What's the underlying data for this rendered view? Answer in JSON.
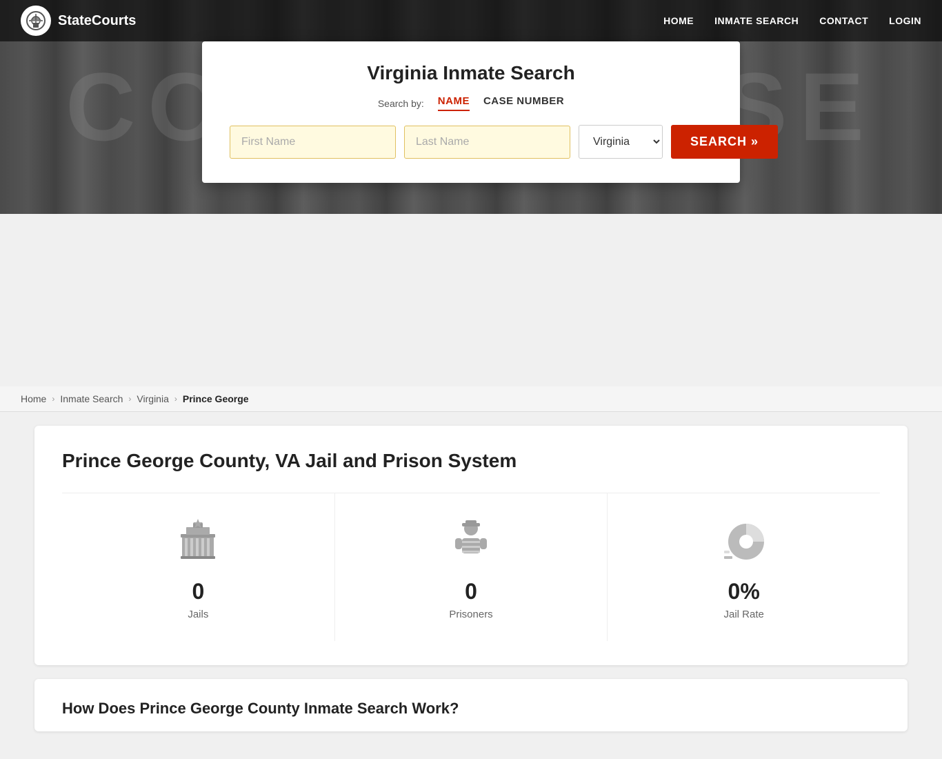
{
  "nav": {
    "logo_text": "StateCourts",
    "links": [
      "HOME",
      "INMATE SEARCH",
      "CONTACT",
      "LOGIN"
    ]
  },
  "header": {
    "bg_text": "COURTHOUSE"
  },
  "search_card": {
    "title": "Virginia Inmate Search",
    "search_by_label": "Search by:",
    "tabs": [
      {
        "id": "name",
        "label": "NAME",
        "active": true
      },
      {
        "id": "case",
        "label": "CASE NUMBER",
        "active": false
      }
    ],
    "first_name_placeholder": "First Name",
    "last_name_placeholder": "Last Name",
    "state_value": "Virginia",
    "search_button_label": "SEARCH »"
  },
  "breadcrumb": {
    "items": [
      {
        "label": "Home",
        "link": true
      },
      {
        "label": "Inmate Search",
        "link": true
      },
      {
        "label": "Virginia",
        "link": true
      },
      {
        "label": "Prince George",
        "link": false
      }
    ]
  },
  "main_card": {
    "title": "Prince George County, VA Jail and Prison System",
    "stats": [
      {
        "id": "jails",
        "value": "0",
        "label": "Jails"
      },
      {
        "id": "prisoners",
        "value": "0",
        "label": "Prisoners"
      },
      {
        "id": "jail_rate",
        "value": "0%",
        "label": "Jail Rate"
      }
    ]
  },
  "second_card": {
    "partial_title": "How Does Prince George County Inmate Search Work?"
  }
}
